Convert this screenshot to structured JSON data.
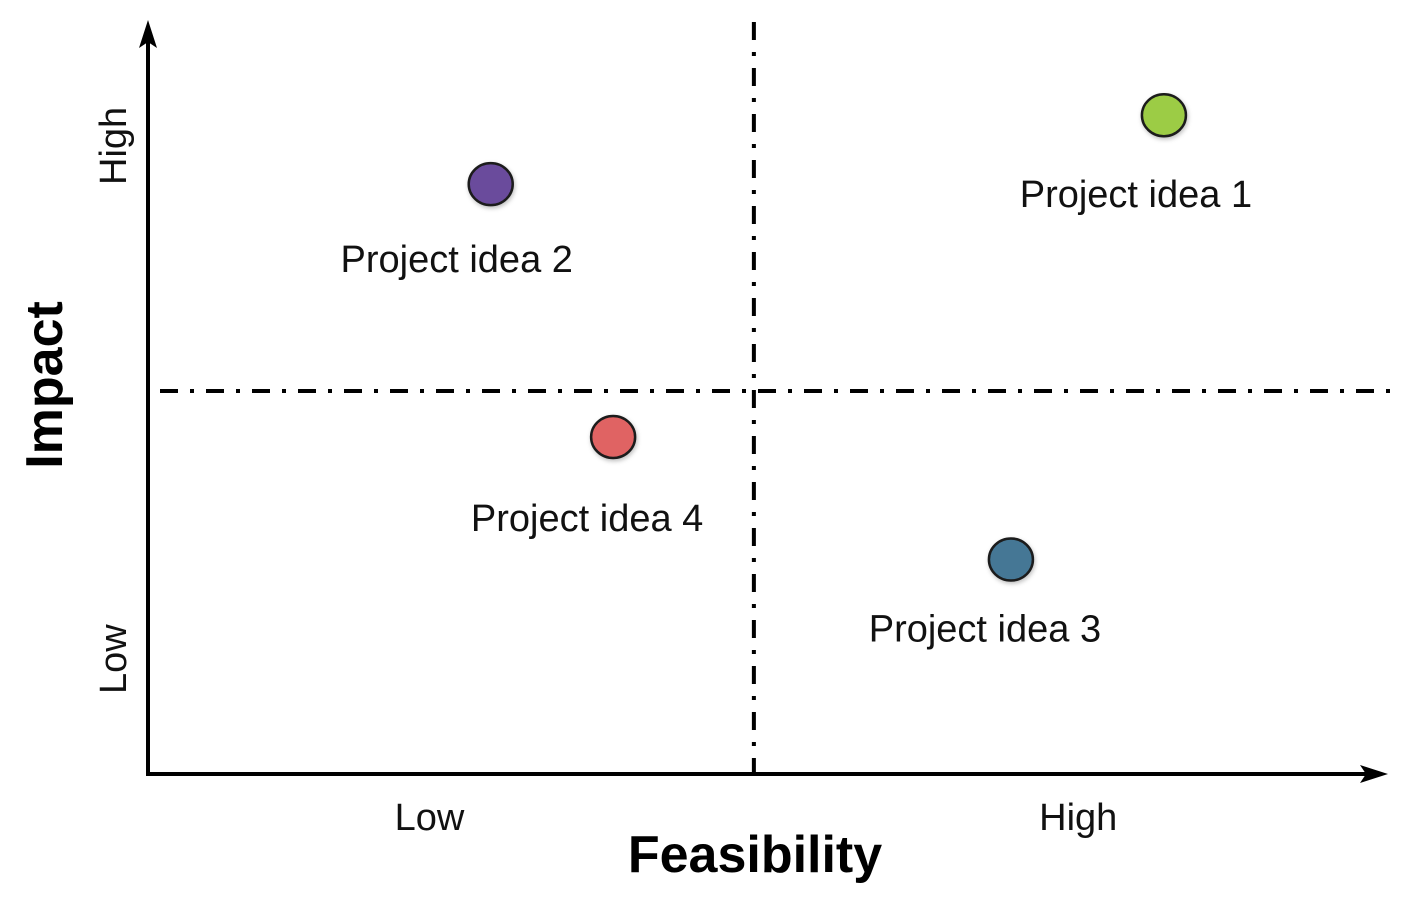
{
  "chart_data": {
    "type": "scatter",
    "title": "",
    "xlabel": "Feasibility",
    "ylabel": "Impact",
    "xlim": [
      0,
      10
    ],
    "ylim": [
      0,
      10
    ],
    "x_tick_labels": [
      {
        "value": 2.3,
        "label": "Low"
      },
      {
        "value": 7.6,
        "label": "High"
      }
    ],
    "y_tick_labels": [
      {
        "value": 1.5,
        "label": "Low"
      },
      {
        "value": 8.2,
        "label": "High"
      }
    ],
    "quadrant_dividers": {
      "x": 4.95,
      "y": 5.0,
      "style": "dash-dot"
    },
    "grid": false,
    "legend": "none",
    "points": [
      {
        "name": "Project idea 1",
        "x": 8.3,
        "y": 8.6,
        "color": "#9ccc45"
      },
      {
        "name": "Project idea 2",
        "x": 2.8,
        "y": 7.7,
        "color": "#6a4c9c"
      },
      {
        "name": "Project idea 3",
        "x": 7.05,
        "y": 2.8,
        "color": "#447795"
      },
      {
        "name": "Project idea 4",
        "x": 3.8,
        "y": 4.4,
        "color": "#e06464"
      }
    ]
  }
}
